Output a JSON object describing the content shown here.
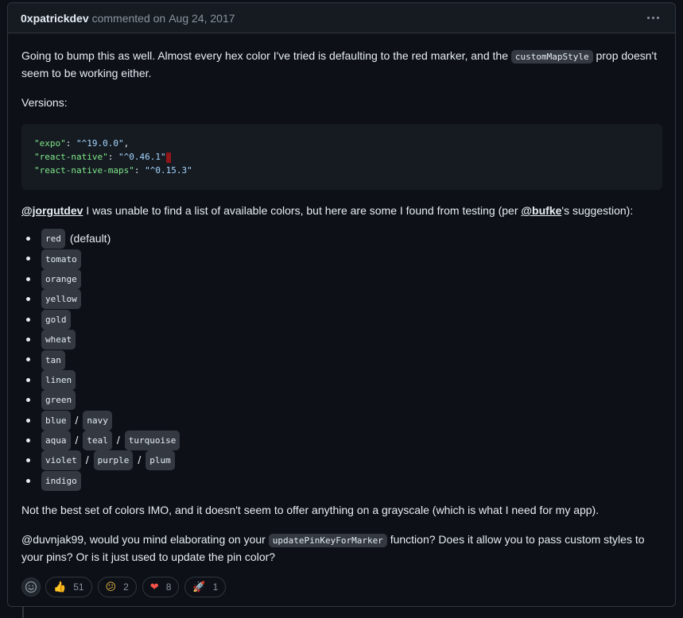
{
  "header": {
    "author": "0xpatrickdev",
    "action": "commented on",
    "date": "Aug 24, 2017"
  },
  "body": {
    "p1_before": "Going to bump this as well. Almost every hex color I've tried is defaulting to the red marker, and the ",
    "p1_code": "customMapStyle",
    "p1_after": " prop doesn't seem to be working either.",
    "versions_label": "Versions:",
    "code_lines": [
      {
        "key": "\"expo\"",
        "sep": ": ",
        "val": "\"^19.0.0\"",
        "end": ","
      },
      {
        "key": "\"react-native\"",
        "sep": ": ",
        "val": "\"^0.46.1\"",
        "end": ""
      },
      {
        "key": "\"react-native-maps\"",
        "sep": ": ",
        "val": "\"^0.15.3\"",
        "end": ""
      }
    ],
    "p2_mention1": "@jorgutdev",
    "p2_middle": " I was unable to find a list of available colors, but here are some I found from testing (per ",
    "p2_mention2": "@bufke",
    "p2_end": "'s suggestion):",
    "colors": [
      [
        "red"
      ],
      [
        "tomato"
      ],
      [
        "orange"
      ],
      [
        "yellow"
      ],
      [
        "gold"
      ],
      [
        "wheat"
      ],
      [
        "tan"
      ],
      [
        "linen"
      ],
      [
        "green"
      ],
      [
        "blue",
        "navy"
      ],
      [
        "aqua",
        "teal",
        "turquoise"
      ],
      [
        "violet",
        "purple",
        "plum"
      ],
      [
        "indigo"
      ]
    ],
    "default_note": "(default)",
    "separator": "/",
    "p3": "Not the best set of colors IMO, and it doesn't seem to offer anything on a grayscale (which is what I need for my app).",
    "p4_before": "@duvnjak99, would you mind elaborating on your ",
    "p4_code": "updatePinKeyForMarker",
    "p4_after": " function? Does it allow you to pass custom styles to your pins? Or is it just used to update the pin color?"
  },
  "reactions": [
    {
      "icon": "thumbs-up-icon",
      "emoji": "👍",
      "count": "51"
    },
    {
      "icon": "confused-icon",
      "emoji": "😕",
      "count": "2"
    },
    {
      "icon": "heart-icon",
      "emoji": "❤",
      "count": "8"
    },
    {
      "icon": "rocket-icon",
      "emoji": "🚀",
      "count": "1"
    }
  ],
  "colors": {
    "background": "#0d1117",
    "header_bg": "#161b22",
    "border": "#30363d",
    "text": "#e6edf3",
    "muted": "#8b949e",
    "code_key": "#7ee787",
    "code_val": "#a5d6ff"
  }
}
